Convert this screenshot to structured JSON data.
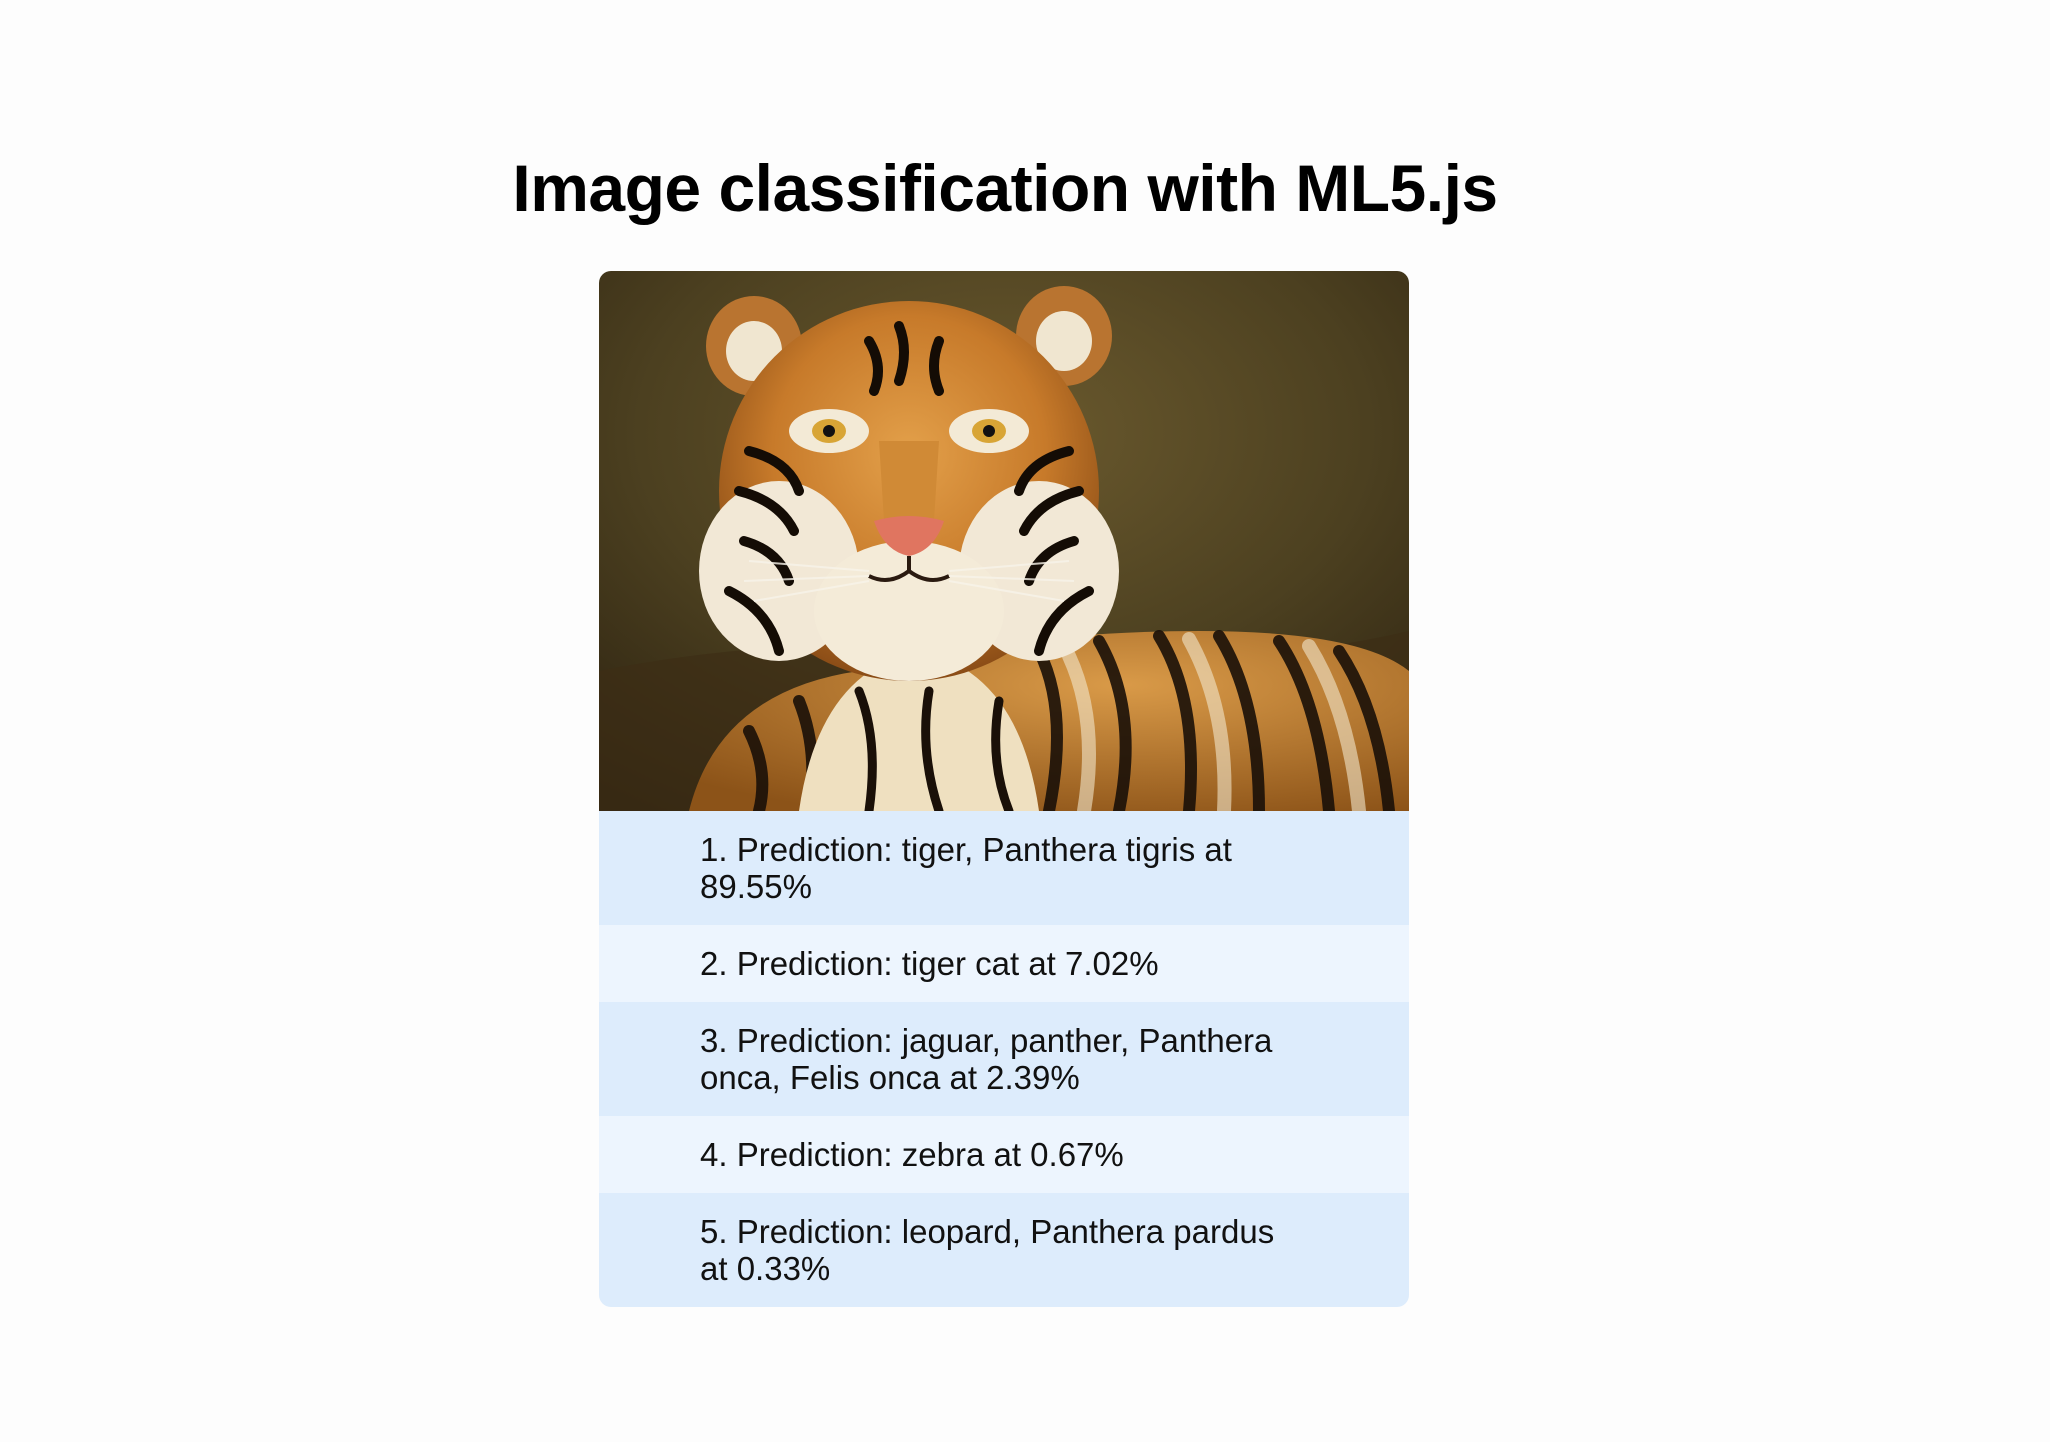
{
  "page": {
    "title": "Image classification with ML5.js"
  },
  "image": {
    "subject": "tiger"
  },
  "predictions": [
    {
      "rank": 1,
      "label": "tiger, Panthera tigris",
      "confidence_percent": 89.55,
      "text": "1. Prediction: tiger, Panthera tigris at 89.55%"
    },
    {
      "rank": 2,
      "label": "tiger cat",
      "confidence_percent": 7.02,
      "text": "2. Prediction: tiger cat at 7.02%"
    },
    {
      "rank": 3,
      "label": "jaguar, panther, Panthera onca, Felis onca",
      "confidence_percent": 2.39,
      "text": "3. Prediction: jaguar, panther, Panthera onca, Felis onca at 2.39%"
    },
    {
      "rank": 4,
      "label": "zebra",
      "confidence_percent": 0.67,
      "text": "4. Prediction: zebra at 0.67%"
    },
    {
      "rank": 5,
      "label": "leopard, Panthera pardus",
      "confidence_percent": 0.33,
      "text": "5. Prediction: leopard, Panthera pardus at 0.33%"
    }
  ],
  "colors": {
    "row_odd": "#ddecfc",
    "row_even": "#edf5fe",
    "page_background": "#fdfdfd"
  }
}
